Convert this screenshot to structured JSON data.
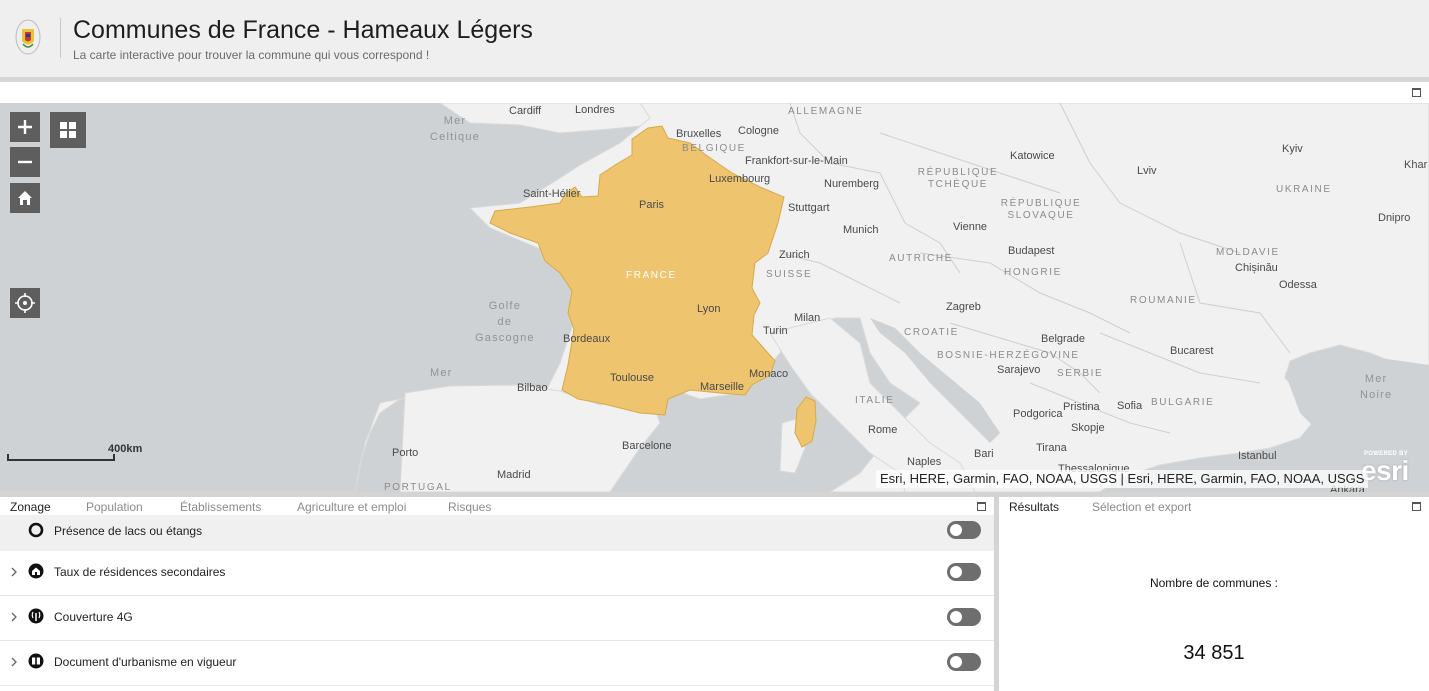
{
  "header": {
    "title": "Communes de France - Hameaux Légers",
    "subtitle": "La carte interactive pour trouver la commune qui vous correspond !",
    "logo_icon": "coat-of-arms-icon"
  },
  "map": {
    "highlight_color": "#eec46f",
    "water_color": "#cfd2d4",
    "land_color": "#f1f1f1",
    "cities": [
      "Cardiff",
      "Londres",
      "Bruxelles",
      "Cologne",
      "Frankfort-sur-le-Main",
      "Luxembourg",
      "Katowice",
      "Kyiv",
      "Khar",
      "Lviv",
      "Nuremberg",
      "Saint-Hélier",
      "Paris",
      "Stuttgart",
      "Munich",
      "Vienne",
      "Dnipro",
      "Zurich",
      "Budapest",
      "Chișinău",
      "Odessa",
      "Lyon",
      "Milan",
      "Zagreb",
      "Turin",
      "Bordeaux",
      "Belgrade",
      "Bucarest",
      "Sarajevo",
      "Monaco",
      "Toulouse",
      "Marseille",
      "Bilbao",
      "Pristina",
      "Sofia",
      "Podgorica",
      "Skopje",
      "Rome",
      "Barcelone",
      "Tirana",
      "Istanbul",
      "Porto",
      "Bari",
      "Naples",
      "Madrid",
      "Thessalonique",
      "Ankara"
    ],
    "countries": [
      "ALLEMAGNE",
      "BELGIQUE",
      "RÉPUBLIQUE TCHÈQUE",
      "RÉPUBLIQUE SLOVAQUE",
      "UKRAINE",
      "FRANCE",
      "AUTRICHE",
      "SUISSE",
      "HONGRIE",
      "MOLDAVIE",
      "ROUMANIE",
      "CROATIE",
      "BOSNIE-HERZÉGOVINE",
      "SERBIE",
      "BULGARIE",
      "ITALIE",
      "PORTUGAL"
    ],
    "seas": {
      "celtic_1": "Mer",
      "celtic_2": "Celtique",
      "gascogne_1": "Golfe",
      "gascogne_2": "de",
      "gascogne_3": "Gascogne",
      "noire_1": "Mer",
      "noire_2": "Noire"
    },
    "scale": "400km",
    "attribution": "Esri, HERE, Garmin, FAO, NOAA, USGS | Esri, HERE, Garmin, FAO, NOAA, USGS",
    "esri_powered": "POWERED BY",
    "esri_brand": "esri",
    "controls": {
      "zoom_in_icon": "plus-icon",
      "zoom_out_icon": "minus-icon",
      "home_icon": "home-icon",
      "basemap_icon": "basemap-gallery-icon",
      "locate_icon": "locate-icon"
    }
  },
  "layers_panel": {
    "tabs": [
      "Zonage",
      "Population",
      "Établissements",
      "Agriculture et emploi",
      "Risques"
    ],
    "active_tab": "Zonage",
    "rows": [
      {
        "label": "Présence de lacs ou étangs",
        "icon": "lake-icon",
        "enabled": false
      },
      {
        "label": "Taux de résidences secondaires",
        "icon": "house-icon",
        "enabled": false
      },
      {
        "label": "Couverture 4G",
        "icon": "antenna-icon",
        "enabled": false
      },
      {
        "label": "Document d'urbanisme en vigueur",
        "icon": "document-icon",
        "enabled": false
      }
    ]
  },
  "results_panel": {
    "tabs": [
      "Résultats",
      "Sélection et export"
    ],
    "active_tab": "Résultats",
    "count_label": "Nombre de communes :",
    "count_value": "34 851"
  }
}
